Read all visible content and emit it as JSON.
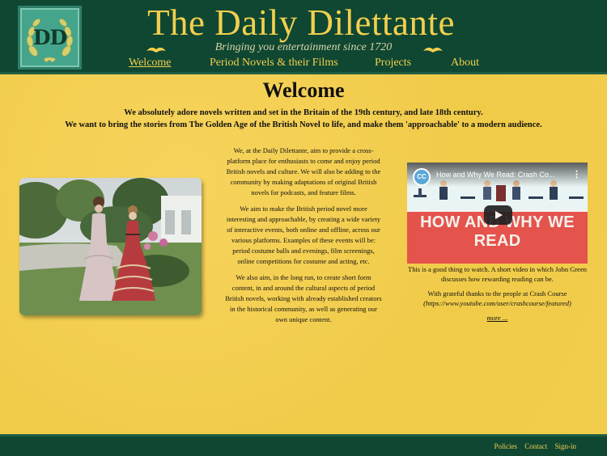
{
  "header": {
    "logo_text": "DD",
    "title": "The Daily Dilettante",
    "tagline": "Bringing you entertainment since 1720"
  },
  "nav": {
    "items": [
      {
        "label": "Welcome",
        "active": true
      },
      {
        "label": "Period Novels & their Films",
        "active": false
      },
      {
        "label": "Projects",
        "active": false
      },
      {
        "label": "About",
        "active": false
      }
    ]
  },
  "main": {
    "heading": "Welcome",
    "intro_line1": "We absolutely adore novels written and set in the Britain of the 19th century, and late 18th century.",
    "intro_line2": "We want to bring the stories from The Golden Age of the British Novel to life, and make them 'approachable' to a modern audience.",
    "paragraphs": [
      "We, at the Daily Dilettante, aim to provide a cross-platform place for enthusiasts to come and enjoy period British novels and culture. We will also be adding to the community by making adaptations of original British novels for podcasts, and feature films.",
      "We aim to make the British period novel more interesting and approachable, by creating a wide variety of interactive events, both online and offline, across our various platforms. Examples of these events will be: period costume balls and evenings, film screenings, online competitions for costume and acting, etc.",
      "We also aim, in the long run, to create short form content, in and around the cultural aspects of period British novels, working with already established creators in the historical community, as well as generating our own unique content."
    ],
    "photo_alt": "photo-two-women-period-costume"
  },
  "video": {
    "badge": "CC",
    "title": "How and Why We Read: Crash Co...",
    "headline": "HOW AND WHY WE READ",
    "caption": "This is a good thing to watch. A short video in which John Green discusses how rewarding reading can be.",
    "thanks": "With grateful thanks to the people at Crash Course",
    "thanks_link": "(https://www.youtube.com/user/crashcourse/featured)",
    "more": "more ..."
  },
  "footer": {
    "links": [
      "Policies",
      "Contact",
      "Sign-in"
    ]
  },
  "colors": {
    "header_green": "#0f4732",
    "accent_gold": "#f2cf4e",
    "background": "#f2cf4e",
    "video_red": "#e5534d"
  }
}
